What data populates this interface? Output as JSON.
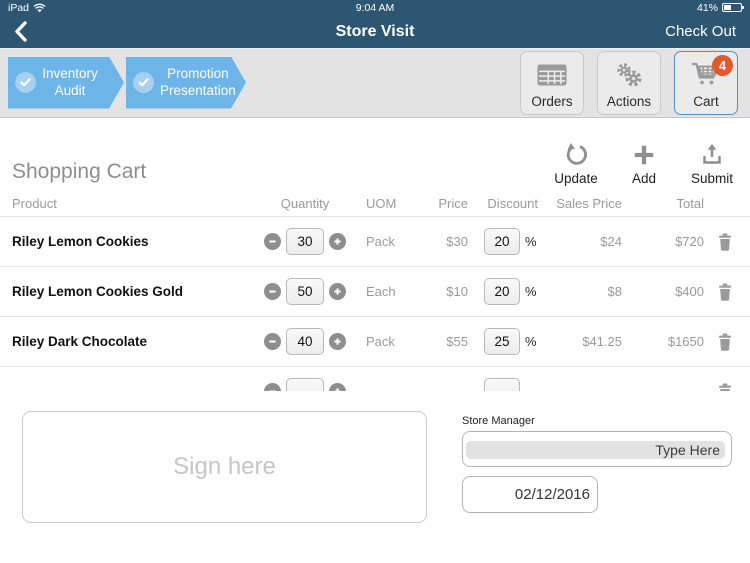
{
  "status_bar": {
    "carrier": "iPad",
    "time": "9:04 AM",
    "battery_percent": "41%"
  },
  "nav_bar": {
    "title": "Store Visit",
    "right_action": "Check Out"
  },
  "workflow": {
    "steps": [
      {
        "label": "Inventory Audit"
      },
      {
        "label": "Promotion Presentation"
      }
    ]
  },
  "toolbar": {
    "orders": {
      "label": "Orders"
    },
    "actions": {
      "label": "Actions"
    },
    "cart": {
      "label": "Cart",
      "badge": "4"
    }
  },
  "cart": {
    "title": "Shopping Cart",
    "actions": {
      "update": {
        "label": "Update"
      },
      "add": {
        "label": "Add"
      },
      "submit": {
        "label": "Submit"
      }
    },
    "table": {
      "columns": [
        "Product",
        "Quantity",
        "UOM",
        "Price",
        "Discount",
        "Sales Price",
        "Total"
      ],
      "rows": [
        {
          "product": "Riley Lemon Cookies",
          "quantity": "30",
          "uom": "Pack",
          "price": "$30",
          "discount": "20",
          "discount_unit": "%",
          "sales_price": "$24",
          "total": "$720"
        },
        {
          "product": "Riley Lemon Cookies Gold",
          "quantity": "50",
          "uom": "Each",
          "price": "$10",
          "discount": "20",
          "discount_unit": "%",
          "sales_price": "$8",
          "total": "$400"
        },
        {
          "product": "Riley Dark Chocolate",
          "quantity": "40",
          "uom": "Pack",
          "price": "$55",
          "discount": "25",
          "discount_unit": "%",
          "sales_price": "$41.25",
          "total": "$1650"
        },
        {
          "product": "",
          "quantity": "",
          "uom": "",
          "price": "",
          "discount": "",
          "discount_unit": "",
          "sales_price": "",
          "total": ""
        }
      ]
    }
  },
  "signature": {
    "placeholder": "Sign here"
  },
  "store_manager": {
    "label": "Store Manager",
    "placeholder": "Type Here",
    "date": "02/12/2016"
  },
  "colors": {
    "nav_bar": "#2d5672",
    "toolbar_bg": "#e3e3e3",
    "step_chevron": "#6db4e9",
    "step_check_circle": "#a5d0f0",
    "cart_badge": "#e2582d",
    "selected_button_border": "#4e92c5",
    "icon_gray": "#9a9a9a",
    "muted_text": "#9a9a9a"
  }
}
